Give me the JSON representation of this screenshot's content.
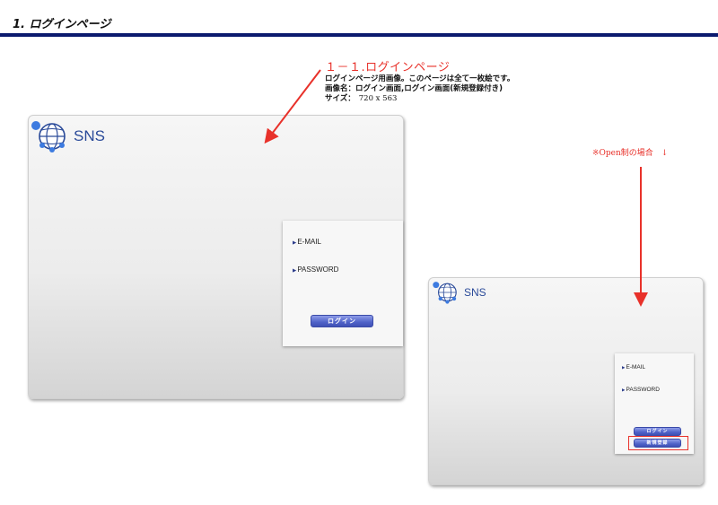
{
  "page": {
    "heading": "1. ログインページ",
    "rule_color": "#0b1a6e"
  },
  "annotation": {
    "title": "１－１.ログインページ",
    "line1": "ログインページ用画像。このページは全て一枚絵です。",
    "line2": "画像名：ログイン画面,ログイン画面(新規登録付き)",
    "line3_label": "サイズ：",
    "line3_value": "720 x 563",
    "accent_color": "#e8312a"
  },
  "open_note": "※Open制の場合　↓",
  "mock_main": {
    "logo_text": "SNS",
    "logo_icon": "globe-icon",
    "email_label": "E-MAIL",
    "password_label": "PASSWORD",
    "login_button": "ログイン"
  },
  "mock_open": {
    "logo_text": "SNS",
    "logo_icon": "globe-icon",
    "email_label": "E-MAIL",
    "password_label": "PASSWORD",
    "login_button": "ログイン",
    "register_button": "新規登録"
  },
  "colors": {
    "brand_blue": "#2a4a99",
    "button_blue": "#4f62c8",
    "highlight_red": "#e8312a"
  }
}
